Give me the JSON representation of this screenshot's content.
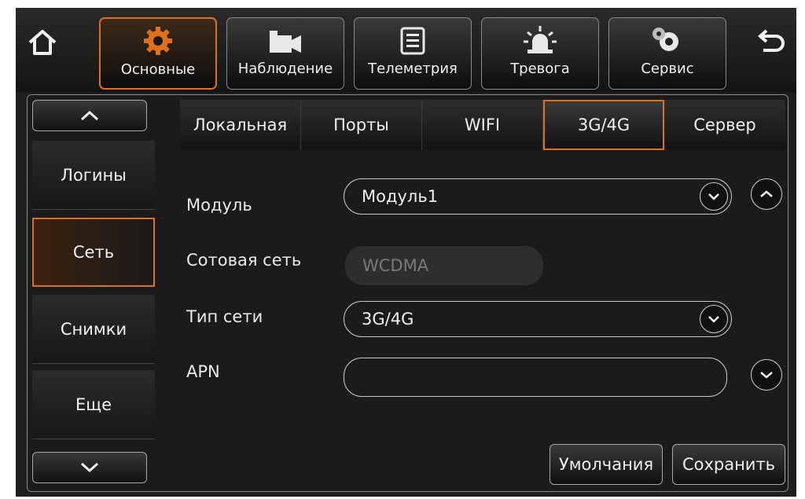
{
  "top_menu": [
    {
      "label": "Основные",
      "icon": "gear-icon",
      "active": true
    },
    {
      "label": "Наблюдение",
      "icon": "camera-icon",
      "active": false
    },
    {
      "label": "Телеметрия",
      "icon": "document-icon",
      "active": false
    },
    {
      "label": "Тревога",
      "icon": "alarm-icon",
      "active": false
    },
    {
      "label": "Сервис",
      "icon": "gears-icon",
      "active": false
    }
  ],
  "sidebar": {
    "items": [
      {
        "label": "Логины",
        "active": false
      },
      {
        "label": "Сеть",
        "active": true
      },
      {
        "label": "Снимки",
        "active": false
      },
      {
        "label": "Еще",
        "active": false
      }
    ]
  },
  "tabs": [
    {
      "label": "Локальная",
      "active": false
    },
    {
      "label": "Порты",
      "active": false
    },
    {
      "label": "WIFI",
      "active": false
    },
    {
      "label": "3G/4G",
      "active": true
    },
    {
      "label": "Сервер",
      "active": false
    }
  ],
  "form": {
    "module": {
      "label": "Модуль",
      "value": "Модуль1"
    },
    "cellular": {
      "label": "Сотовая сеть",
      "value": "WCDMA"
    },
    "network_type": {
      "label": "Тип сети",
      "value": "3G/4G"
    },
    "apn": {
      "label": "APN",
      "value": ""
    }
  },
  "actions": {
    "defaults": "Умолчания",
    "save": "Сохранить"
  },
  "colors": {
    "accent": "#e0701c",
    "background": "#1f1f1f"
  }
}
